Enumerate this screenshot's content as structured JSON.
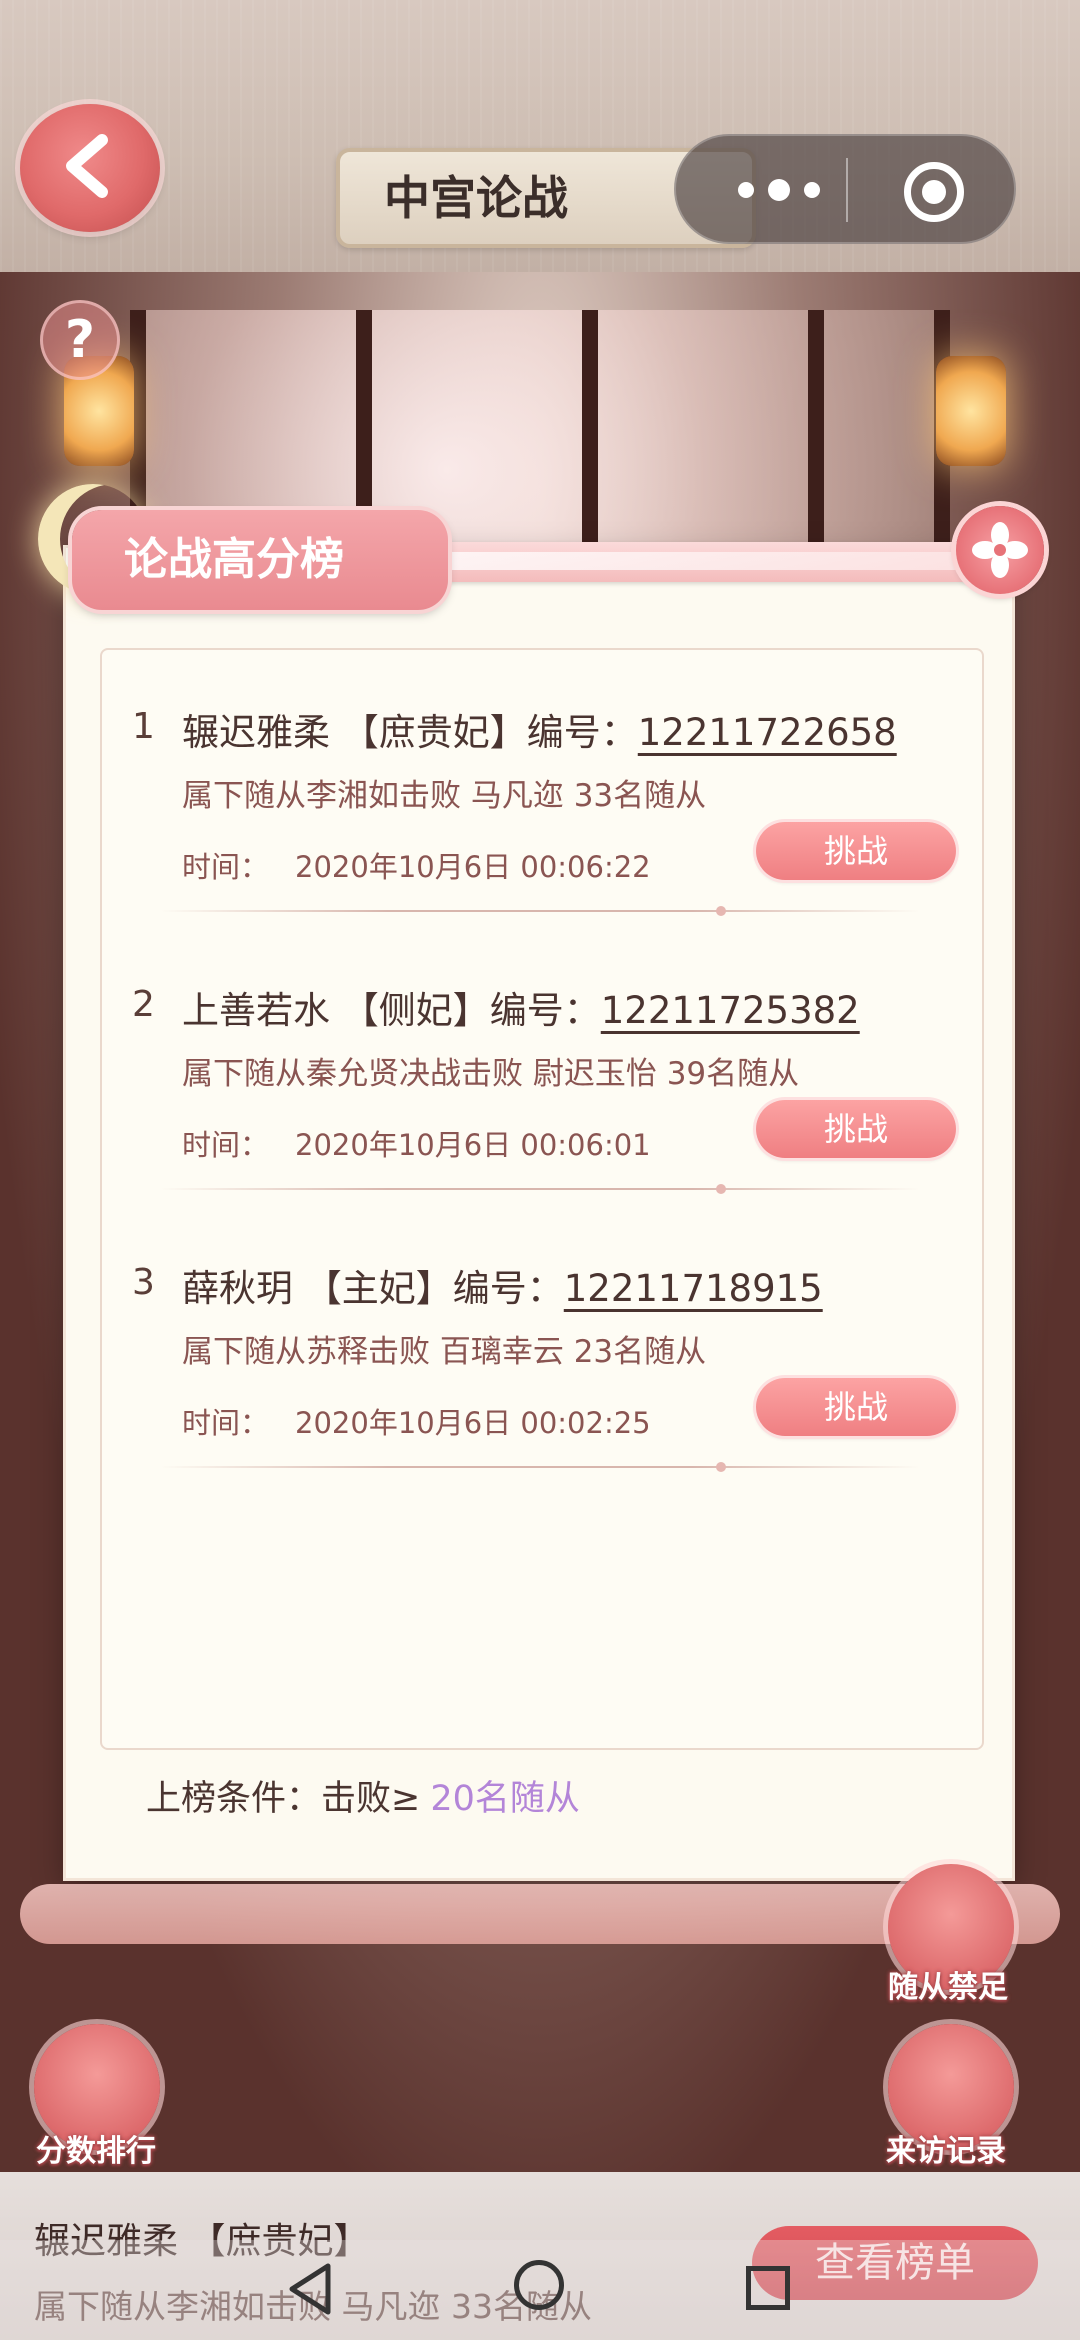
{
  "header": {
    "title": "中宫论战"
  },
  "panel": {
    "tab_title": "论战高分榜",
    "condition_label": "上榜条件：击败≥",
    "condition_value": "20名随从"
  },
  "entries": [
    {
      "rank": "1",
      "name_rank": "辗迟雅柔 【庶贵妃】编号：",
      "id": "12211722658",
      "desc": "属下随从李湘如击败 马凡迩 33名随从",
      "time_label": "时间：",
      "time": "2020年10月6日 00:06:22",
      "button": "挑战"
    },
    {
      "rank": "2",
      "name_rank": "上善若水 【侧妃】编号：",
      "id": "12211725382",
      "desc": "属下随从秦允贤决战击败 尉迟玉怡 39名随从",
      "time_label": "时间：",
      "time": "2020年10月6日 00:06:01",
      "button": "挑战"
    },
    {
      "rank": "3",
      "name_rank": "薛秋玥 【主妃】编号：",
      "id": "12211718915",
      "desc": "属下随从苏释击败 百璃幸云 23名随从",
      "time_label": "时间：",
      "time": "2020年10月6日 00:02:25",
      "button": "挑战"
    }
  ],
  "side_buttons": {
    "follower_ban": "随从禁足",
    "score_rank": "分数排行",
    "visit_record": "来访记录"
  },
  "ticker": {
    "line1": "辗迟雅柔 【庶贵妃】",
    "line2": "属下随从李湘如击败 马凡迩 33名随从",
    "view_button": "查看榜单"
  },
  "icons": {
    "back": "chevron-left-icon",
    "more": "more-dots-icon",
    "target": "target-icon",
    "help": "question-icon",
    "close": "flower-close-icon"
  }
}
